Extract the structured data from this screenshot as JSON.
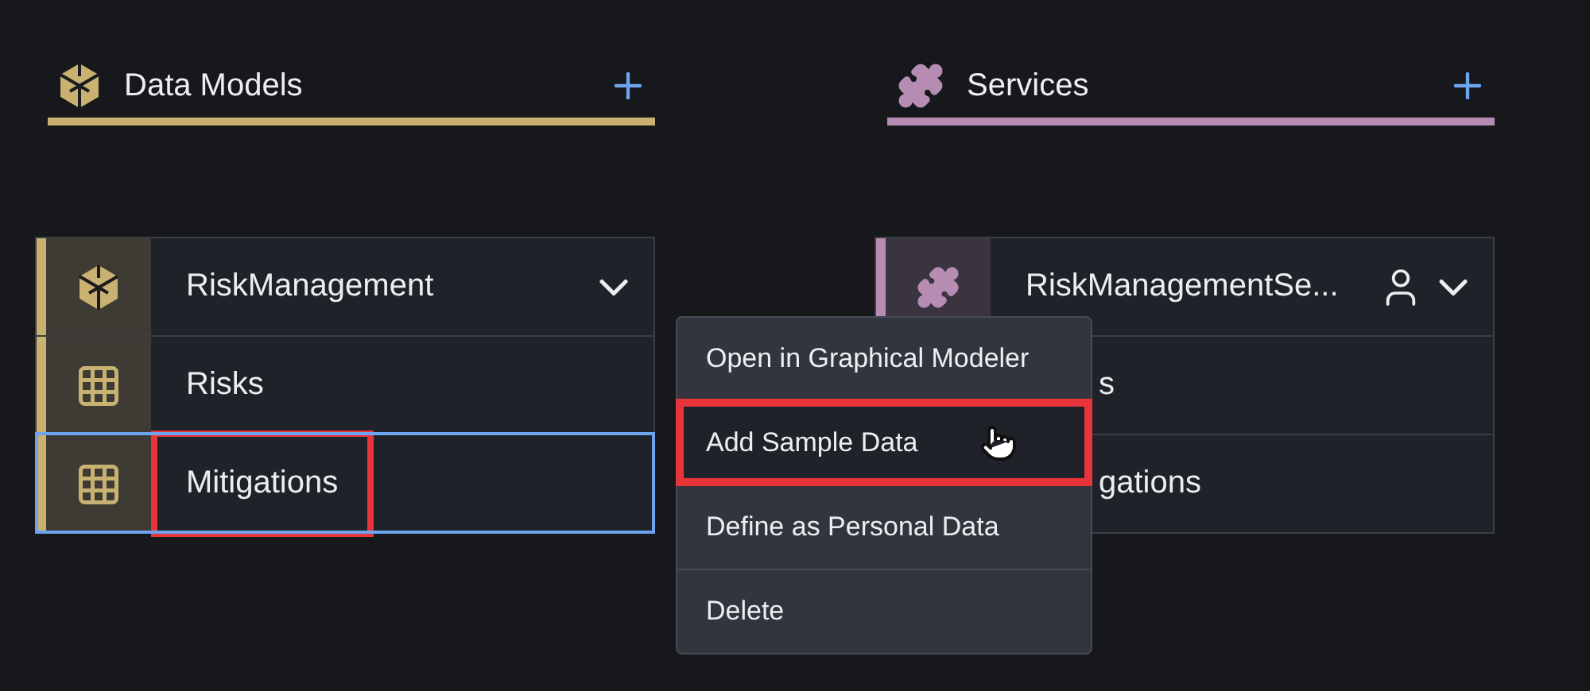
{
  "columns": [
    {
      "kind": "models",
      "title": "Data Models",
      "color": "#c9b271",
      "card": {
        "title": "RiskManagement",
        "personal": false,
        "expanded": true,
        "children": [
          {
            "label": "Risks",
            "kind": "table",
            "selected": false,
            "annotated": false
          },
          {
            "label": "Mitigations",
            "kind": "table",
            "selected": true,
            "annotated": true
          }
        ]
      }
    },
    {
      "kind": "services",
      "title": "Services",
      "color": "#b68cb3",
      "card": {
        "title": "RiskManagementSe...",
        "personal": true,
        "expanded": true,
        "children": [
          {
            "label": "s",
            "selected": false,
            "annotated": false
          },
          {
            "label": "gations",
            "selected": false,
            "annotated": false
          }
        ]
      }
    }
  ],
  "context_menu": {
    "items": [
      {
        "label": "Open in Graphical Modeler",
        "selected": false,
        "annotated": false
      },
      {
        "label": "Add Sample Data",
        "selected": true,
        "annotated": true
      },
      {
        "label": "Define as Personal Data",
        "selected": false,
        "annotated": false
      },
      {
        "label": "Delete",
        "selected": false,
        "annotated": false
      }
    ]
  }
}
